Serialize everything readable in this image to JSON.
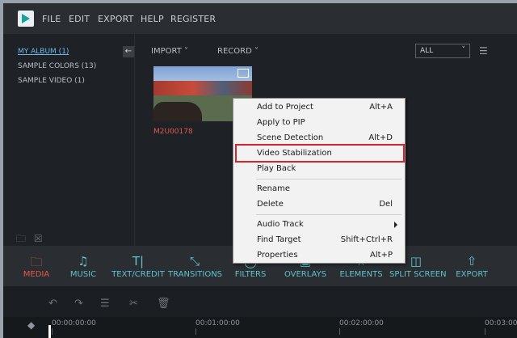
{
  "menu": {
    "items": [
      "FILE",
      "EDIT",
      "EXPORT",
      "HELP",
      "REGISTER"
    ]
  },
  "albums": [
    {
      "label": "MY ALBUM (1)",
      "active": true
    },
    {
      "label": "SAMPLE COLORS (13)",
      "active": false
    },
    {
      "label": "SAMPLE VIDEO (1)",
      "active": false
    }
  ],
  "media_toolbar": {
    "import_label": "IMPORT",
    "record_label": "RECORD",
    "filter_value": "ALL"
  },
  "media_item": {
    "name": "M2U00178"
  },
  "context_menu": {
    "items": [
      {
        "label": "Add to Project",
        "shortcut": "Alt+A"
      },
      {
        "label": "Apply to PIP",
        "shortcut": ""
      },
      {
        "label": "Scene Detection",
        "shortcut": "Alt+D"
      },
      {
        "label": "Video Stabilization",
        "shortcut": ""
      },
      {
        "label": "Play Back",
        "shortcut": ""
      },
      {
        "label": "Rename",
        "shortcut": ""
      },
      {
        "label": "Delete",
        "shortcut": "Del"
      },
      {
        "label": "Audio Track",
        "shortcut": ""
      },
      {
        "label": "Find Target",
        "shortcut": "Shift+Ctrl+R"
      },
      {
        "label": "Properties",
        "shortcut": "Alt+P"
      }
    ]
  },
  "tabs": [
    {
      "label": "MEDIA",
      "icon": "folder-icon"
    },
    {
      "label": "MUSIC",
      "icon": "music-note-icon"
    },
    {
      "label": "TEXT/CREDIT",
      "icon": "text-icon"
    },
    {
      "label": "TRANSITIONS",
      "icon": "transitions-icon"
    },
    {
      "label": "FILTERS",
      "icon": "filters-icon"
    },
    {
      "label": "OVERLAYS",
      "icon": "overlays-icon"
    },
    {
      "label": "ELEMENTS",
      "icon": "elements-icon"
    },
    {
      "label": "SPLIT SCREEN",
      "icon": "split-screen-icon"
    },
    {
      "label": "EXPORT",
      "icon": "export-icon"
    }
  ],
  "timeline": {
    "timecodes": [
      "00:00:00:00",
      "00:01:00:00",
      "00:02:00:00",
      "00:03:00"
    ]
  },
  "colors": {
    "accent": "#5fc2c7",
    "active_tab": "#e35847",
    "highlight": "#d8232a",
    "album_active": "#6fb6e6"
  }
}
